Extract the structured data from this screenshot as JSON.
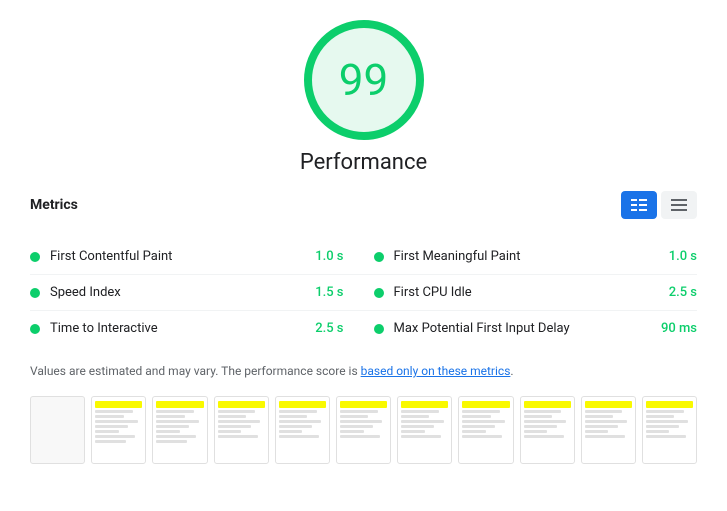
{
  "score": {
    "value": "99",
    "label": "Performance"
  },
  "metrics_section": {
    "title": "Metrics",
    "toggle": {
      "list_label": "≡≡",
      "grid_label": "☰"
    }
  },
  "metrics": [
    {
      "name": "First Contentful Paint",
      "value": "1.0 s",
      "color": "#0cce6b"
    },
    {
      "name": "First Meaningful Paint",
      "value": "1.0 s",
      "color": "#0cce6b"
    },
    {
      "name": "Speed Index",
      "value": "1.5 s",
      "color": "#0cce6b"
    },
    {
      "name": "First CPU Idle",
      "value": "2.5 s",
      "color": "#0cce6b"
    },
    {
      "name": "Time to Interactive",
      "value": "2.5 s",
      "color": "#0cce6b"
    },
    {
      "name": "Max Potential First Input Delay",
      "value": "90 ms",
      "color": "#0cce6b"
    }
  ],
  "note": {
    "text_before": "Values are estimated and may vary. The performance score is ",
    "link_text": "based only on these metrics",
    "text_after": "."
  },
  "filmstrip": {
    "items_count": 11
  }
}
